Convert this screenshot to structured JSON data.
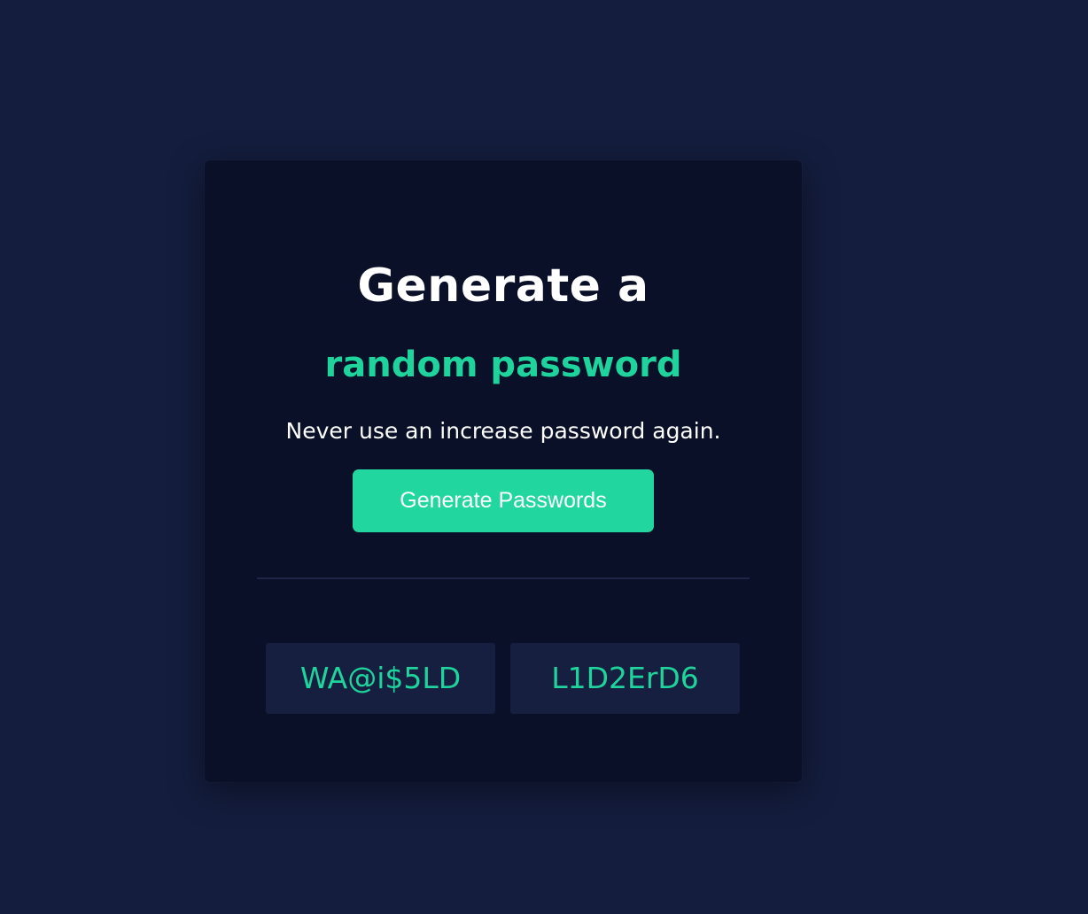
{
  "card": {
    "title": "Generate a",
    "subtitle": "random password",
    "tagline": "Never use an increase password again.",
    "generate_label": "Generate Passwords"
  },
  "passwords": [
    "WA@i$5LD",
    "L1D2ErD6"
  ],
  "colors": {
    "background": "#141d3e",
    "card": "#0a1028",
    "accent": "#22d79f",
    "accent_text": "#1fd39c",
    "password_box": "#161f3f"
  }
}
